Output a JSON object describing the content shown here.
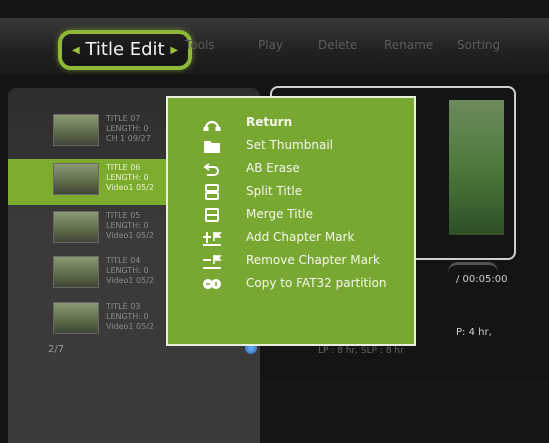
{
  "tabs": [
    {
      "label": "Title Edit",
      "active": true
    },
    {
      "label": "Tools",
      "active": false
    },
    {
      "label": "Play",
      "active": false
    },
    {
      "label": "Delete",
      "active": false
    },
    {
      "label": "Rename",
      "active": false
    },
    {
      "label": "Sorting",
      "active": false
    }
  ],
  "titles": [
    {
      "name": "TITLE 07",
      "length": "LENGTH: 0",
      "info": "CH 1 09/27",
      "selected": false
    },
    {
      "name": "TITLE 06",
      "length": "LENGTH: 0",
      "info": "Video1 05/2",
      "selected": true
    },
    {
      "name": "TITLE 05",
      "length": "LENGTH: 0",
      "info": "Video1 05/2",
      "selected": false
    },
    {
      "name": "TITLE 04",
      "length": "LENGTH: 0",
      "info": "Video1 05/2",
      "selected": false
    },
    {
      "name": "TITLE 03",
      "length": "LENGTH: 0",
      "info": "Video1 05/2",
      "selected": false
    }
  ],
  "pager": "2/7",
  "preview": {
    "time": "/ 00:05:00",
    "hours": "P: 4 hr,",
    "lp_info": "LP : 8 hr,      SLP : 8 hr"
  },
  "menu": [
    {
      "label": "Return",
      "icon": "return-icon",
      "active": true
    },
    {
      "label": "Set Thumbnail",
      "icon": "folder-icon",
      "active": false
    },
    {
      "label": "AB Erase",
      "icon": "undo-arrow-icon",
      "active": false
    },
    {
      "label": "Split Title",
      "icon": "split-icon",
      "active": false
    },
    {
      "label": "Merge Title",
      "icon": "merge-icon",
      "active": false
    },
    {
      "label": "Add Chapter Mark",
      "icon": "add-chapter-icon",
      "active": false
    },
    {
      "label": "Remove Chapter Mark",
      "icon": "remove-chapter-icon",
      "active": false
    },
    {
      "label": "Copy to FAT32 partition",
      "icon": "copy-icon",
      "active": false
    }
  ],
  "colors": {
    "accent_green": "#79a832",
    "highlight_green": "#7cab2e",
    "tab_border": "#8fb838",
    "scroll_blue": "#3a86e0"
  }
}
